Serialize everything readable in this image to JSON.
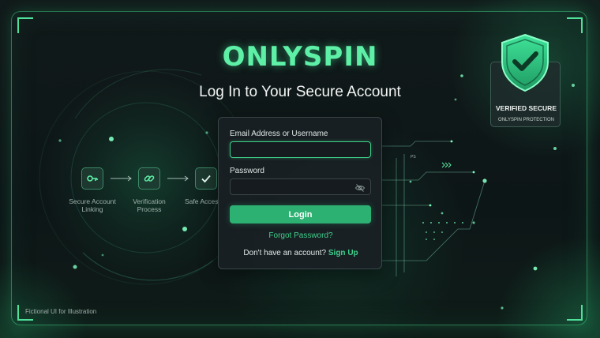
{
  "brand": {
    "logo_text": "ONLYSPIN"
  },
  "header": {
    "title": "Log In to Your Secure Account"
  },
  "login_form": {
    "email_label": "Email Address or Username",
    "email_value": "",
    "password_label": "Password",
    "password_value": "",
    "login_button": "Login",
    "forgot_password": "Forgot Password?",
    "signup_prompt": "Don't have an account?",
    "signup_link": "Sign Up"
  },
  "steps": [
    {
      "label": "Secure Account Linking",
      "icon": "key-icon"
    },
    {
      "label": "Verification Process",
      "icon": "link-icon"
    },
    {
      "label": "Safe Access",
      "icon": "checkmark-icon"
    }
  ],
  "badge": {
    "title": "VERIFIED SECURE",
    "subtitle": "ONLYSPIN PROTECTION",
    "icon": "shield-check-icon"
  },
  "circuit": {
    "tag": "PS"
  },
  "footer": {
    "note": "Fictional UI for Illustration"
  },
  "colors": {
    "accent": "#3fcf8a",
    "logo": "#5ef0a6",
    "button": "#2db173",
    "background": "#0d1617"
  }
}
